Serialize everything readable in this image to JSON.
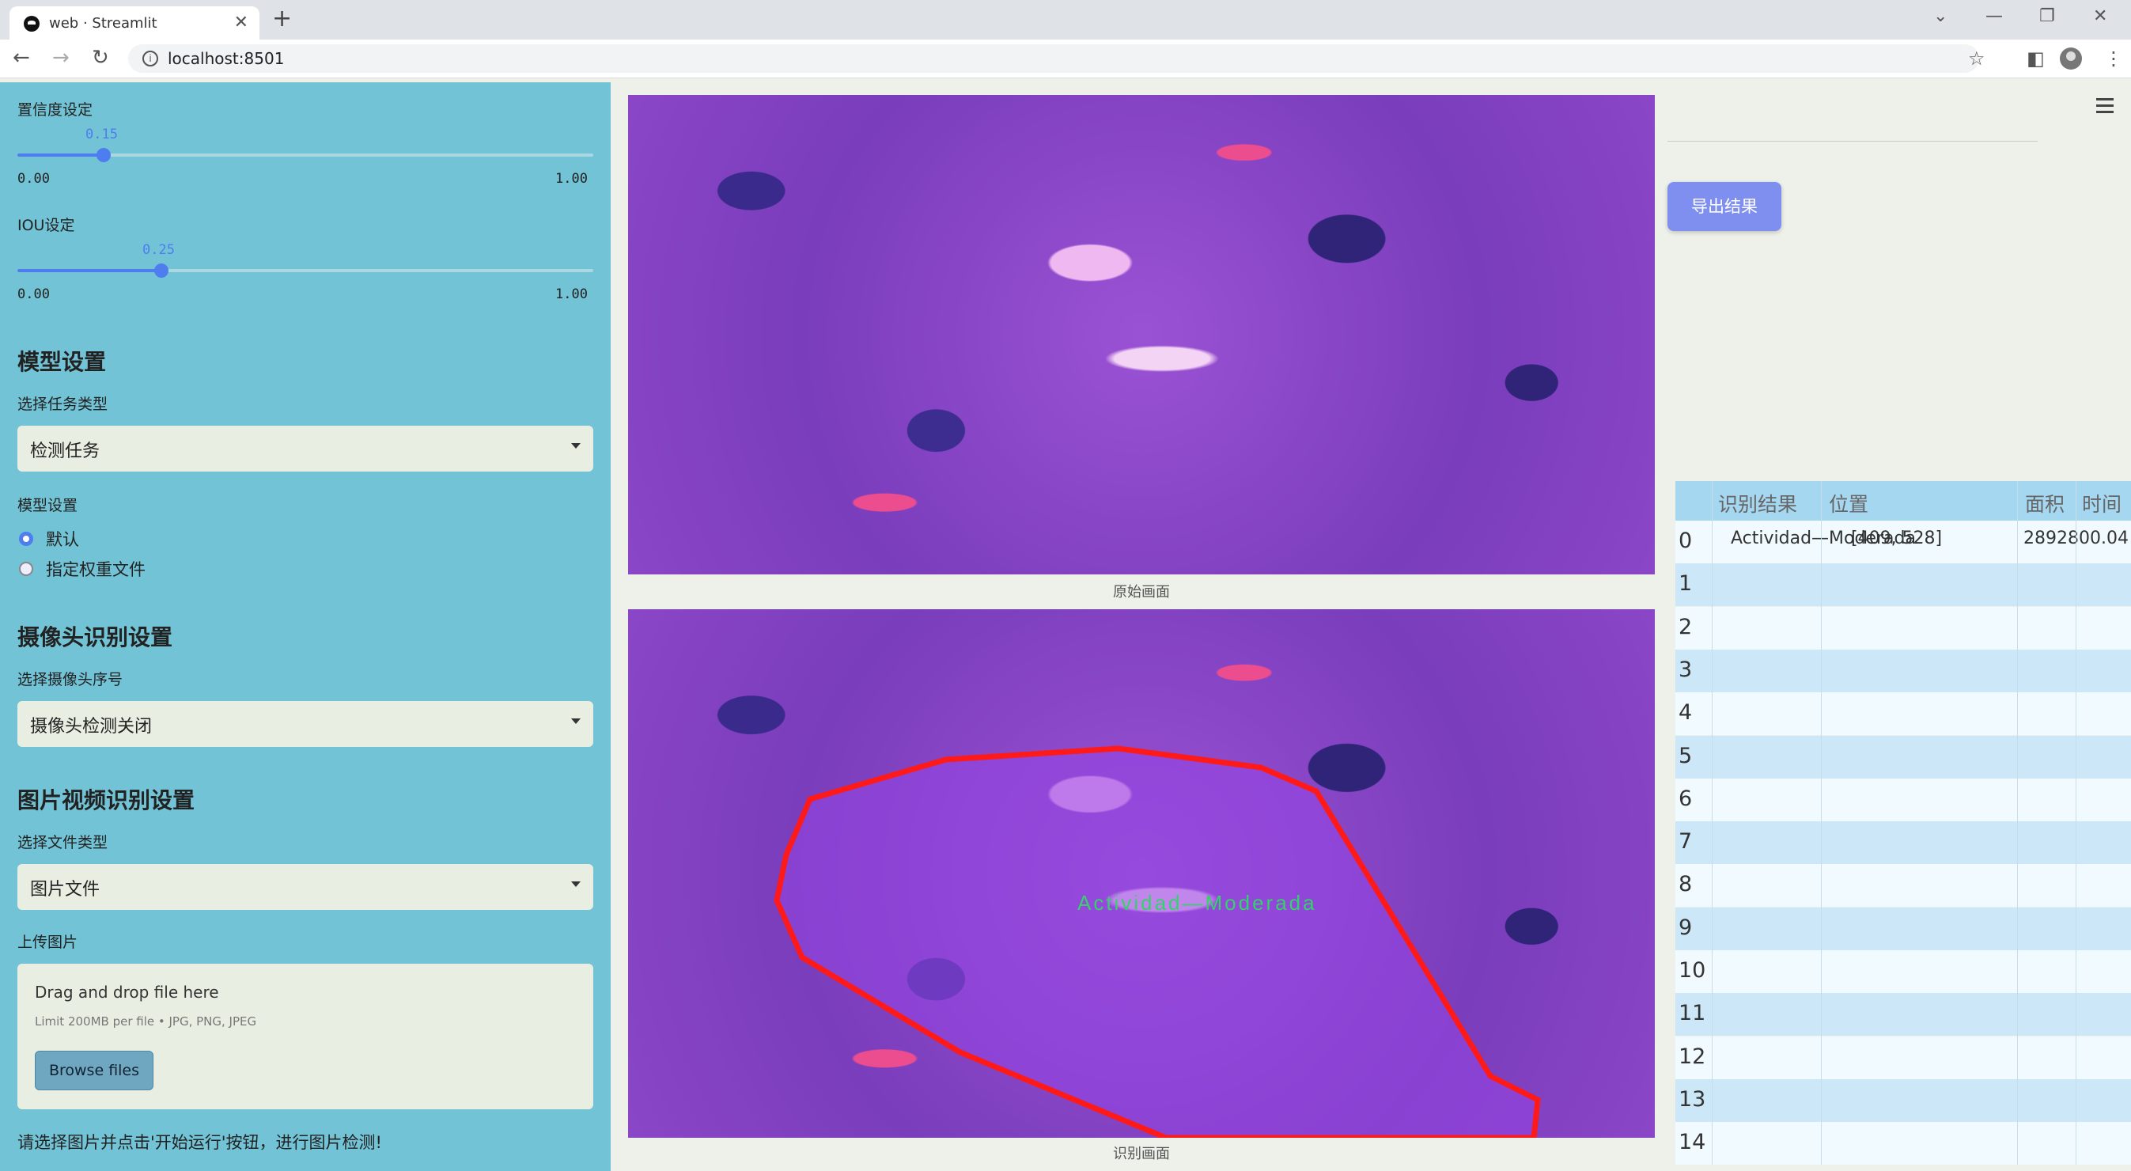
{
  "browser": {
    "tab_title": "web · Streamlit",
    "new_tab": "+",
    "url": "localhost:8501",
    "win_controls": [
      "⌄",
      "—",
      "❐",
      "✕"
    ],
    "nav": [
      "←",
      "→",
      "↻"
    ]
  },
  "sidebar": {
    "confidence": {
      "label": "置信度设定",
      "value": "0.15",
      "min": "0.00",
      "max": "1.00",
      "fraction": 0.15
    },
    "iou": {
      "label": "IOU设定",
      "value": "0.25",
      "min": "0.00",
      "max": "1.00",
      "fraction": 0.25
    },
    "model_heading": "模型设置",
    "task_label": "选择任务类型",
    "task_value": "检测任务",
    "model_label": "模型设置",
    "model_options": [
      "默认",
      "指定权重文件"
    ],
    "model_selected": 0,
    "camera_heading": "摄像头识别设置",
    "camera_label": "选择摄像头序号",
    "camera_value": "摄像头检测关闭",
    "media_heading": "图片视频识别设置",
    "filetype_label": "选择文件类型",
    "filetype_value": "图片文件",
    "upload_label": "上传图片",
    "upload_title": "Drag and drop file here",
    "upload_limit": "Limit 200MB per file • JPG, PNG, JPEG",
    "browse_label": "Browse files",
    "hint": "请选择图片并点击'开始运行'按钮，进行图片检测!"
  },
  "main": {
    "original_caption": "原始画面",
    "result_caption": "识别画面",
    "detection_label": "Actividad—Moderada",
    "colors": {
      "polygon": "#ff1a1a",
      "label_text": "#35d16a"
    }
  },
  "right": {
    "export_label": "导出结果",
    "table": {
      "headers": [
        "识别结果",
        "位置",
        "面积",
        "时间"
      ],
      "rows": [
        {
          "idx": "0",
          "result": "Actividad—Moderada",
          "pos": "[409, 528]",
          "area": "2892800.04"
        },
        {
          "idx": "1"
        },
        {
          "idx": "2"
        },
        {
          "idx": "3"
        },
        {
          "idx": "4"
        },
        {
          "idx": "5"
        },
        {
          "idx": "6"
        },
        {
          "idx": "7"
        },
        {
          "idx": "8"
        },
        {
          "idx": "9"
        },
        {
          "idx": "10"
        },
        {
          "idx": "11"
        },
        {
          "idx": "12"
        },
        {
          "idx": "13"
        },
        {
          "idx": "14"
        }
      ]
    }
  }
}
